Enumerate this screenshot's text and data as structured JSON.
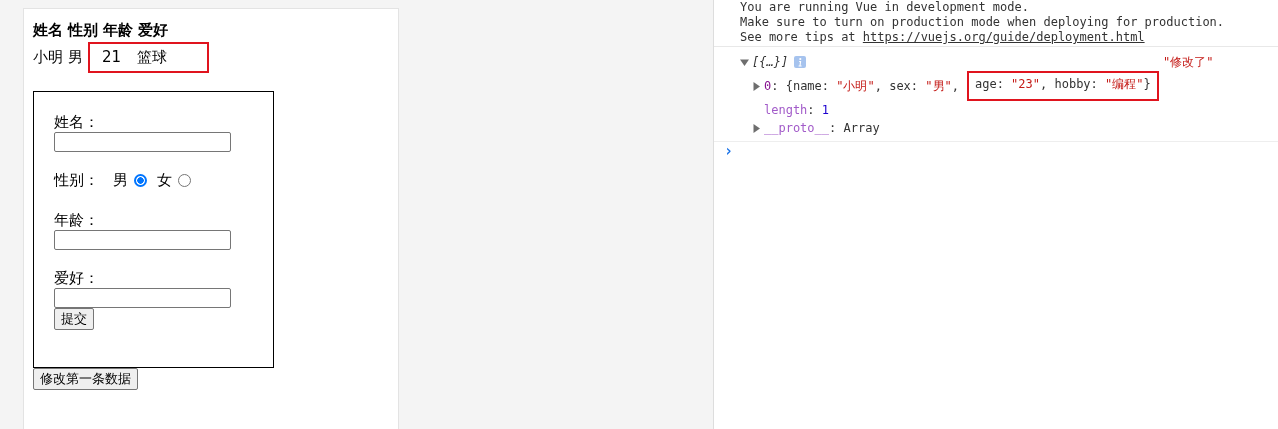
{
  "page": {
    "table": {
      "headers": [
        "姓名",
        "性别",
        "年龄",
        "爱好"
      ],
      "rows": [
        [
          {
            "text": "小明",
            "highlighted": false
          },
          {
            "text": "男",
            "highlighted": false
          },
          {
            "text": "21",
            "highlighted": true
          },
          {
            "text": "篮球",
            "highlighted": true
          }
        ]
      ]
    },
    "form": {
      "fields": [
        {
          "kind": "text",
          "label": "姓名："
        },
        {
          "kind": "radio",
          "label": "性别：",
          "options": [
            {
              "label": "男",
              "selected": true
            },
            {
              "label": "女",
              "selected": false
            }
          ]
        },
        {
          "kind": "text",
          "label": "年龄："
        },
        {
          "kind": "text",
          "label": "爱好："
        }
      ],
      "submit": "提交"
    },
    "update_button": "修改第一条数据"
  },
  "console": {
    "messages": [
      "You are running Vue in development mode.",
      "Make sure to turn on production mode when deploying for production."
    ],
    "tip": {
      "text": "See more tips at",
      "link": "https://vuejs.org/guide/deployment.html"
    },
    "log": {
      "summary": "[{…}]",
      "expanded": true,
      "note": "\"修改了\"",
      "entries": [
        {
          "kind": "object",
          "expanded": false,
          "segments": [
            {
              "kind": "index",
              "text": "0",
              "highlighted": false
            },
            {
              "kind": "plain",
              "text": ": {name: ",
              "highlighted": false
            },
            {
              "kind": "string",
              "text": "\"小明\"",
              "highlighted": false
            },
            {
              "kind": "plain",
              "text": ", sex: ",
              "highlighted": false
            },
            {
              "kind": "string",
              "text": "\"男\"",
              "highlighted": false
            },
            {
              "kind": "plain",
              "text": ",",
              "highlighted": false
            },
            {
              "kind": "plain",
              "text": "age: ",
              "highlighted": true
            },
            {
              "kind": "string",
              "text": "\"23\"",
              "highlighted": true
            },
            {
              "kind": "plain",
              "text": ", hobby: ",
              "highlighted": true
            },
            {
              "kind": "string",
              "text": "\"编程\"",
              "highlighted": true
            },
            {
              "kind": "plain",
              "text": "}",
              "highlighted": true
            }
          ]
        },
        {
          "kind": "number",
          "segments": [
            {
              "kind": "meta",
              "text": "length",
              "highlighted": false
            },
            {
              "kind": "plain",
              "text": ": ",
              "highlighted": false
            },
            {
              "kind": "number",
              "text": "1",
              "highlighted": false
            }
          ]
        },
        {
          "kind": "proto",
          "expanded": false,
          "segments": [
            {
              "kind": "meta",
              "text": "__proto__",
              "highlighted": false
            },
            {
              "kind": "plain",
              "text": ": Array",
              "highlighted": false
            }
          ]
        }
      ]
    },
    "prompt": "›"
  }
}
